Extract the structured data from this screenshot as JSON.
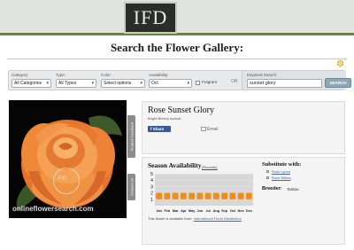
{
  "header": {
    "logo_text": "IFD"
  },
  "page_title": "Search the Flower Gallery:",
  "filters": {
    "category": {
      "label": "Category:",
      "value": "All Categories"
    },
    "type": {
      "label": "Type:",
      "value": "All Types"
    },
    "color": {
      "label": "Color:",
      "value": "Select options"
    },
    "availability": {
      "label": "Availability:",
      "value": "Oct"
    },
    "fragrant_label": "Fragrant",
    "or_label": "OR",
    "keyword": {
      "label": "Keyword Search:",
      "value": "sunset glory"
    },
    "search_button": "SEARCH"
  },
  "photo": {
    "watermark": "onlineflowersearch.com"
  },
  "side_tabs": {
    "product_feedback": "Product Feedback",
    "contact_us": "Contact Us"
  },
  "product": {
    "name": "Rose Sunset Glory",
    "subtitle": "Bright Breezy Apricot",
    "share_label": "Share",
    "email_label": "Email"
  },
  "availability": {
    "title": "Season Availability",
    "legend_link": "(Records)",
    "note_text": "This flower is available from: ",
    "note_link": "International Floral Distribution"
  },
  "substitute": {
    "title": "Substitute with:",
    "items": [
      "Rose Lyrica",
      "Rose Wilma"
    ]
  },
  "breeder": {
    "label": "Breeder:",
    "value": "Tantau"
  },
  "chart_data": {
    "type": "bar",
    "title": "Season Availability",
    "categories": [
      "Jan",
      "Feb",
      "Mar",
      "Apr",
      "May",
      "Jun",
      "Jul",
      "Aug",
      "Sep",
      "Oct",
      "Nov",
      "Dec"
    ],
    "values": [
      2,
      2,
      2,
      2,
      2,
      2,
      2,
      2,
      2,
      2,
      2,
      2
    ],
    "ylim": [
      0,
      5
    ],
    "yticks": [
      1,
      2,
      3,
      4,
      5
    ],
    "bar_color": "#f08c1a",
    "background": "#d7d7d7"
  }
}
